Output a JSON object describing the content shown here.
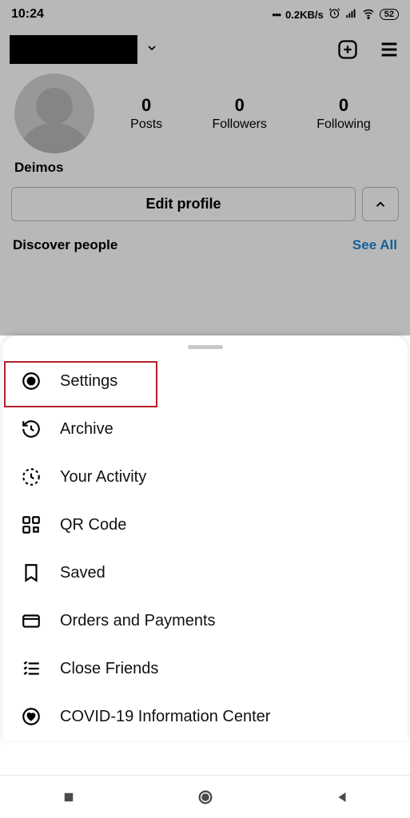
{
  "status": {
    "time": "10:24",
    "speed": "0.2KB/s",
    "battery": "52"
  },
  "profile": {
    "posts_count": "0",
    "posts_label": "Posts",
    "followers_count": "0",
    "followers_label": "Followers",
    "following_count": "0",
    "following_label": "Following",
    "display_name": "Deimos",
    "edit_label": "Edit profile"
  },
  "discover": {
    "title": "Discover people",
    "see_all": "See All"
  },
  "menu": {
    "settings": "Settings",
    "archive": "Archive",
    "activity": "Your Activity",
    "qr": "QR Code",
    "saved": "Saved",
    "orders": "Orders and Payments",
    "close_friends": "Close Friends",
    "covid": "COVID-19 Information Center"
  }
}
